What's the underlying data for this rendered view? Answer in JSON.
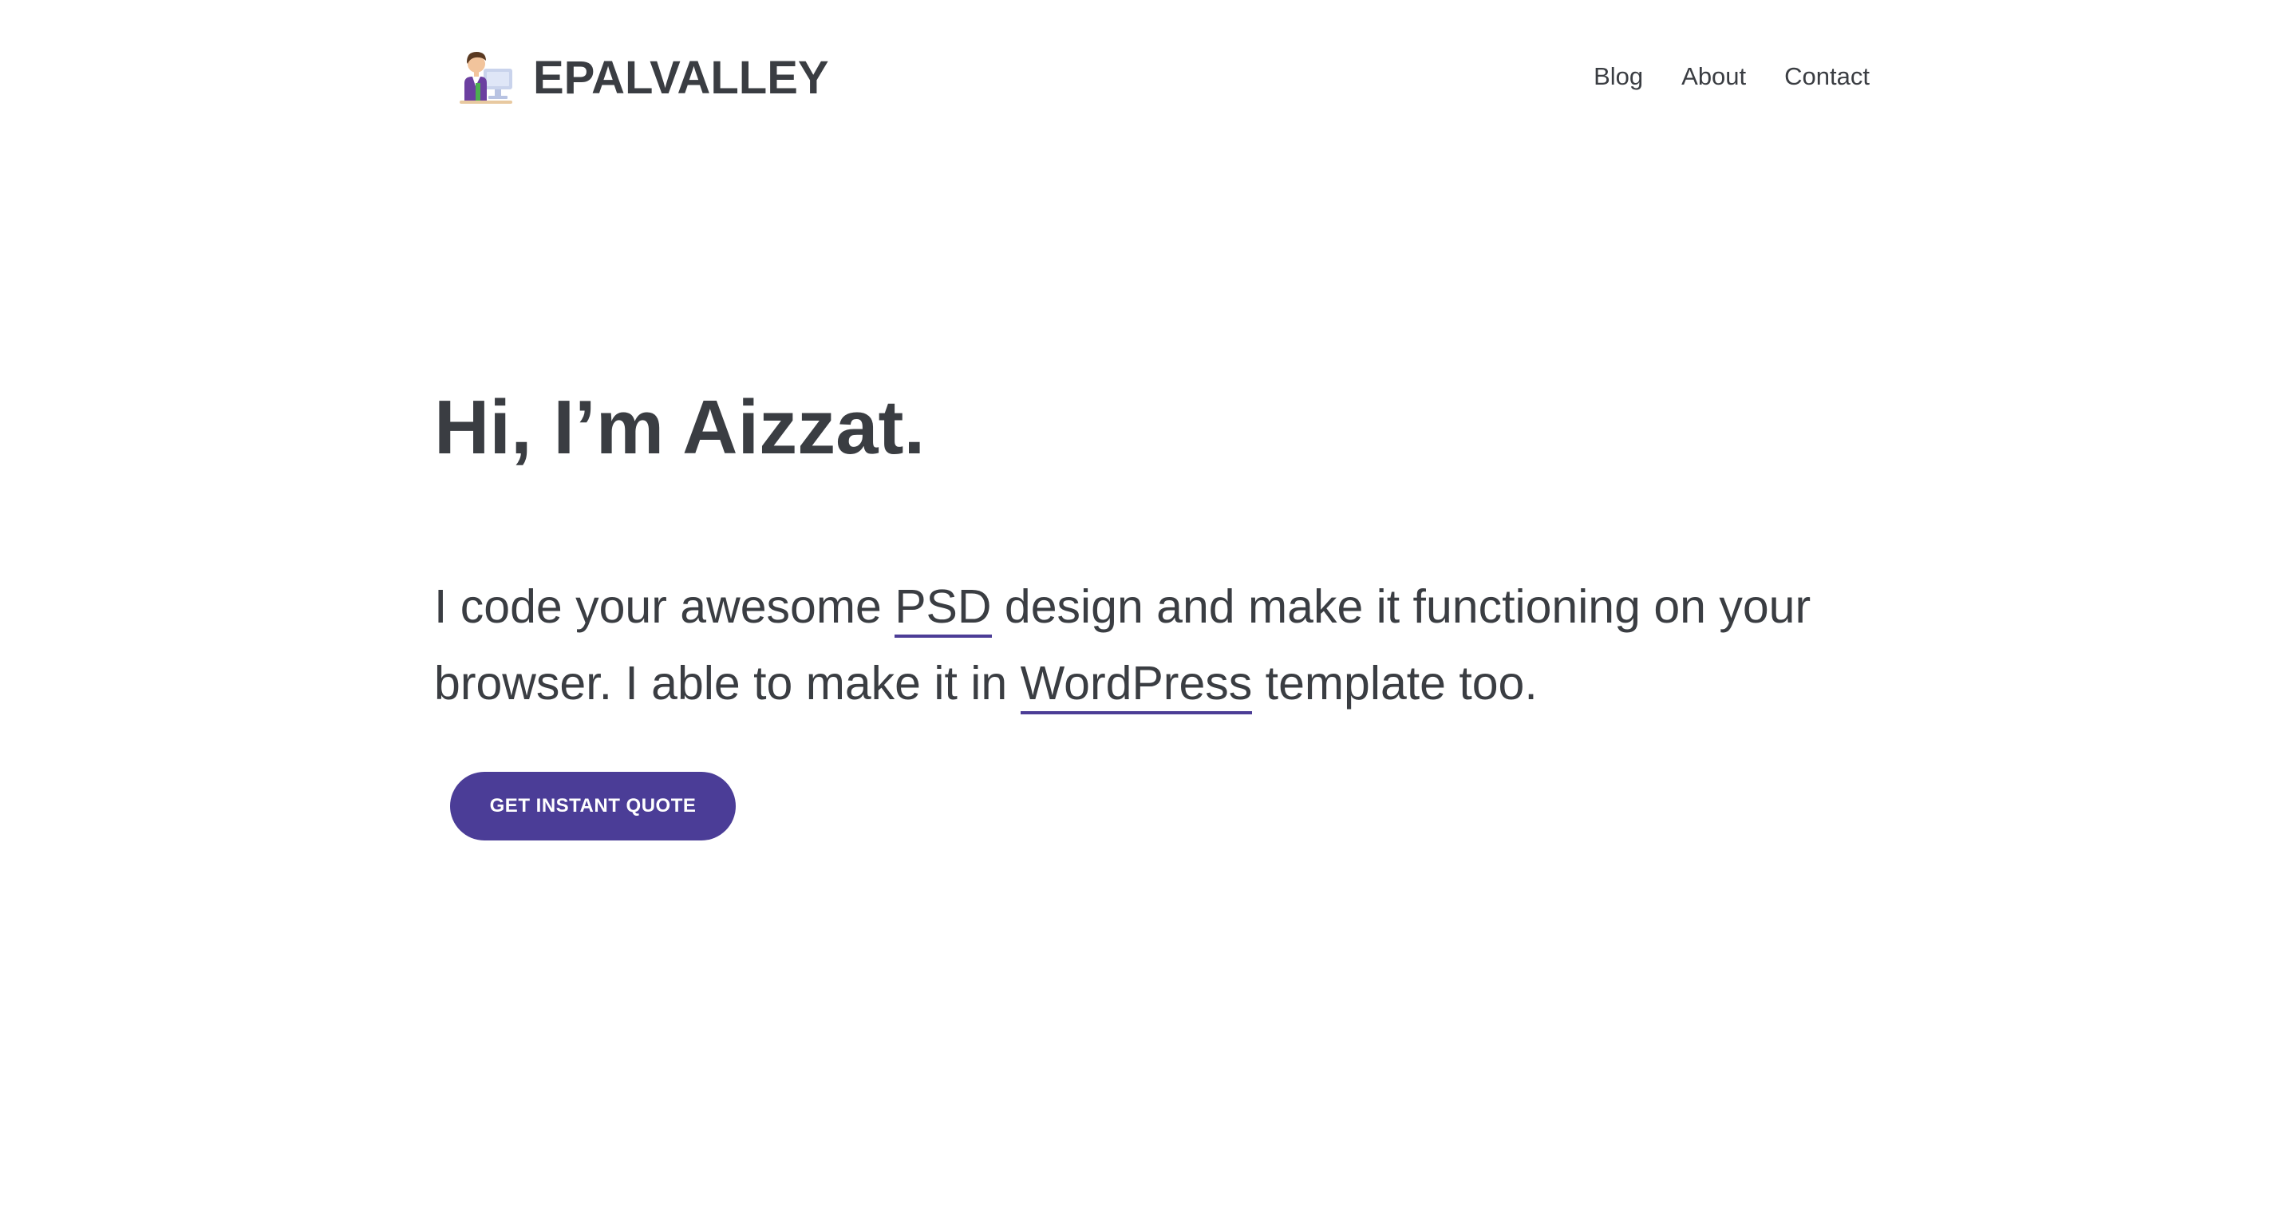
{
  "header": {
    "logo_icon": "developer-avatar-icon",
    "brand": "EPALVALLEY",
    "nav": [
      {
        "label": "Blog"
      },
      {
        "label": "About"
      },
      {
        "label": "Contact"
      }
    ]
  },
  "hero": {
    "title": "Hi, I’m Aizzat.",
    "text_part1": "I code your awesome ",
    "link_psd": "PSD",
    "text_part2": " design and make it functioning on your browser. I able to make it in ",
    "link_wordpress": "WordPress",
    "text_part3": " template too.",
    "cta_label": "GET INSTANT QUOTE"
  },
  "colors": {
    "text": "#3a3d42",
    "accent": "#4b3d97",
    "background": "#ffffff"
  }
}
